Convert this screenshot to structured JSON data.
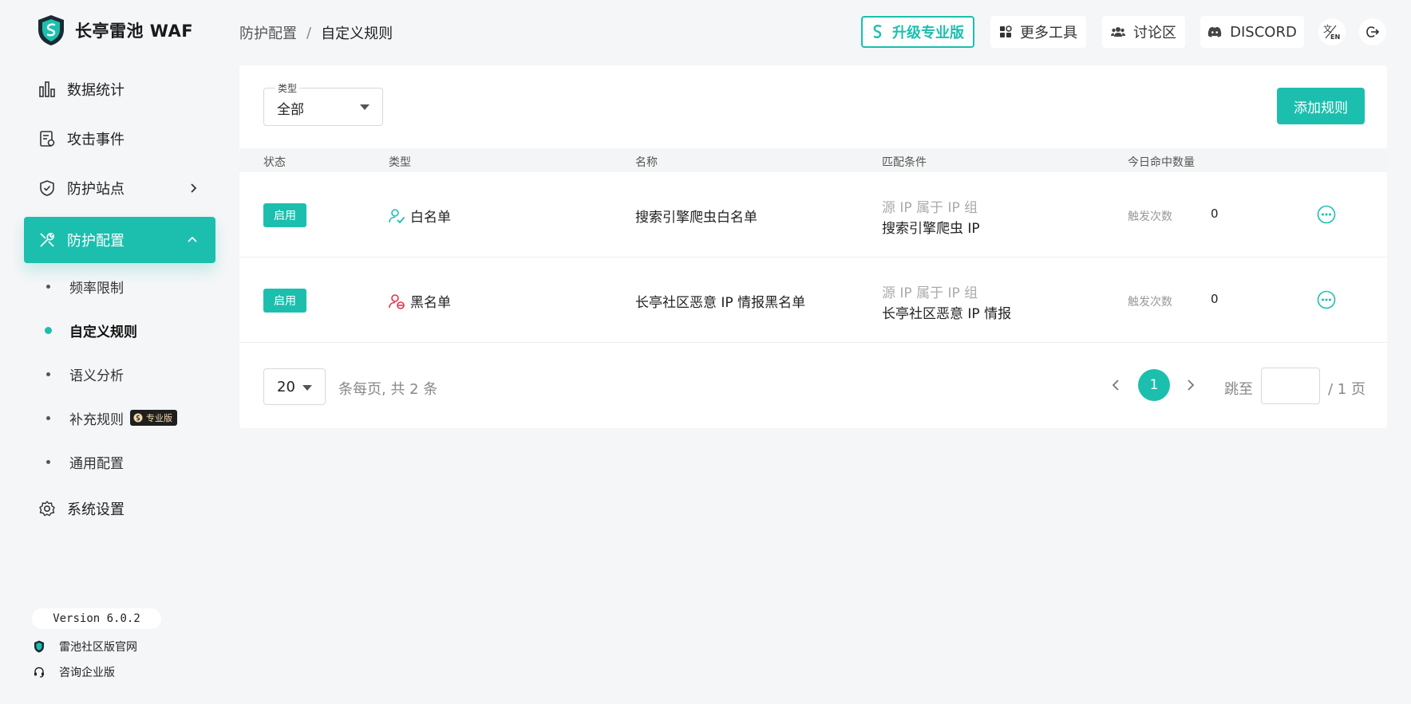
{
  "app": {
    "title": "长亭雷池 WAF"
  },
  "sidebar": {
    "items": [
      {
        "label": "数据统计",
        "icon": "bar-chart-icon"
      },
      {
        "label": "攻击事件",
        "icon": "event-log-icon"
      },
      {
        "label": "防护站点",
        "icon": "shield-check-icon"
      },
      {
        "label": "防护配置",
        "icon": "tools-icon"
      },
      {
        "label": "系统设置",
        "icon": "gear-icon"
      }
    ],
    "sub_items": [
      {
        "label": "频率限制"
      },
      {
        "label": "自定义规则"
      },
      {
        "label": "语义分析"
      },
      {
        "label": "补充规则",
        "badge": "专业版"
      },
      {
        "label": "通用配置"
      }
    ],
    "version": "Version 6.0.2",
    "footer_links": [
      {
        "label": "雷池社区版官网"
      },
      {
        "label": "咨询企业版"
      }
    ]
  },
  "header": {
    "breadcrumb": {
      "parent": "防护配置",
      "separator": "/",
      "current": "自定义规则"
    },
    "buttons": {
      "upgrade": "升级专业版",
      "tools": "更多工具",
      "forum": "讨论区",
      "discord": "DISCORD"
    }
  },
  "filter": {
    "label": "类型",
    "value": "全部"
  },
  "add_rule_label": "添加规则",
  "table": {
    "columns": [
      "状态",
      "类型",
      "名称",
      "匹配条件",
      "今日命中数量"
    ],
    "rows": [
      {
        "status": "启用",
        "type": "白名单",
        "name": "搜索引擎爬虫白名单",
        "cond_title": "源 IP 属于 IP 组",
        "cond_value": "搜索引擎爬虫 IP",
        "hit_label": "触发次数",
        "hit_value": "0"
      },
      {
        "status": "启用",
        "type": "黑名单",
        "name": "长亭社区恶意 IP 情报黑名单",
        "cond_title": "源 IP 属于 IP 组",
        "cond_value": "长亭社区恶意 IP 情报",
        "hit_label": "触发次数",
        "hit_value": "0"
      }
    ]
  },
  "pagination": {
    "page_size": "20",
    "info": "条每页, 共 2 条",
    "current": "1",
    "jump_label": "跳至",
    "total_label": "/ 1 页"
  },
  "colors": {
    "accent": "#1cbfae",
    "whitelist": "#1cbfae",
    "blacklist": "#e0344b"
  }
}
